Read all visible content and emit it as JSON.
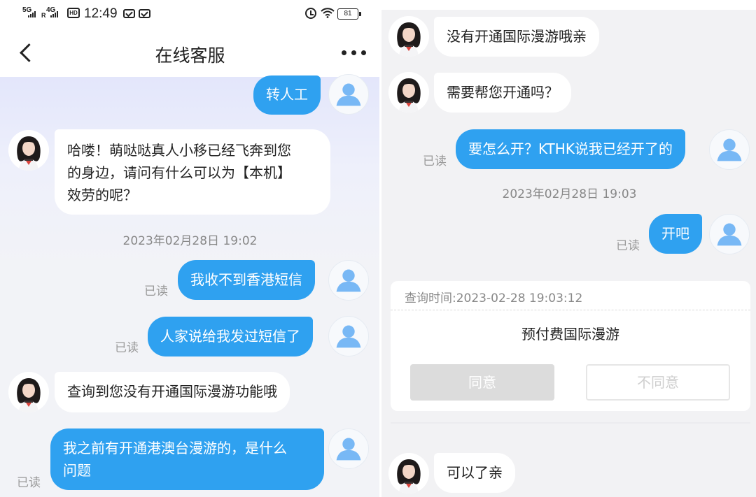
{
  "status_bar": {
    "net1": "5G",
    "net1_sub": "",
    "net2": "4G",
    "net2_sub": "R",
    "hd": "HD",
    "time": "12:49",
    "battery": "81"
  },
  "header": {
    "title": "在线客服"
  },
  "left_messages": [
    {
      "from": "user",
      "text": "转人工"
    },
    {
      "from": "agent",
      "lines": [
        "哈喽！萌哒哒真人小移已经飞奔到您",
        "的身边，请问有什么可以为【本机】",
        "效劳的呢？"
      ]
    },
    {
      "type": "timestamp",
      "text": "2023年02月28日 19:02"
    },
    {
      "from": "user",
      "text": "我收不到香港短信",
      "read": "已读"
    },
    {
      "from": "user",
      "text": "人家说给我发过短信了",
      "read": "已读"
    },
    {
      "from": "agent",
      "text": "查询到您没有开通国际漫游功能哦"
    },
    {
      "from": "user",
      "lines": [
        "我之前有开通港澳台漫游的，是什么",
        "问题"
      ],
      "read": "已读"
    }
  ],
  "right_messages": [
    {
      "from": "agent",
      "text": "没有开通国际漫游哦亲"
    },
    {
      "from": "agent",
      "text": "需要帮您开通吗？"
    },
    {
      "from": "user",
      "text": "要怎么开？KTHK说我已经开了的",
      "read": "已读"
    },
    {
      "type": "timestamp",
      "text": "2023年02月28日 19:03"
    },
    {
      "from": "user",
      "text": "开吧",
      "read": "已读"
    },
    {
      "from": "agent",
      "text": "可以了亲"
    }
  ],
  "card": {
    "query_time": "查询时间:2023-02-28 19:03:12",
    "title": "预付费国际漫游",
    "agree_label": "同意",
    "disagree_label": "不同意"
  },
  "icons": {
    "back": "back-arrow-icon",
    "more": "more-dots-icon",
    "user_avatar": "default-user-avatar",
    "agent_avatar": "agent-avatar",
    "wifi": "wifi-icon",
    "alarm": "alarm-icon",
    "mail": "mail-icon"
  },
  "colors": {
    "user_bubble": "#2fa1f0",
    "agent_bubble": "#ffffff",
    "read_text": "#9a9a9a"
  }
}
